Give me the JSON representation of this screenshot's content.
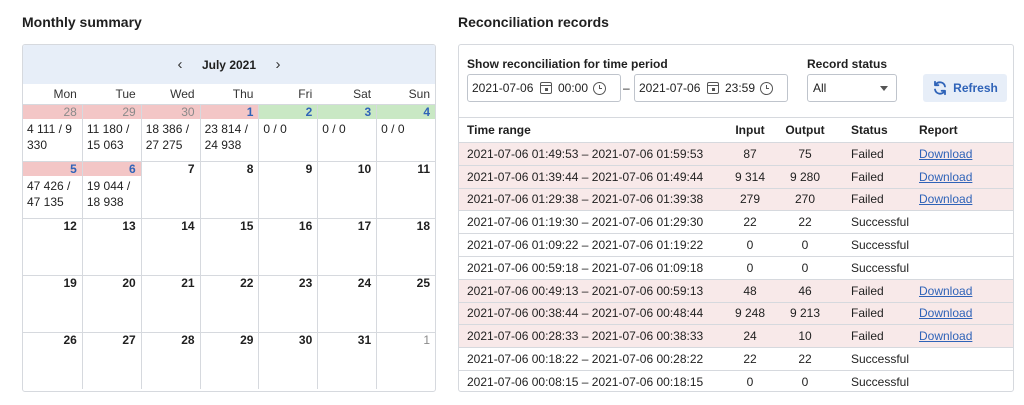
{
  "left_title": "Monthly summary",
  "right_title": "Reconciliation records",
  "calendar": {
    "month_label": "July 2021",
    "prev_symbol": "‹",
    "next_symbol": "›",
    "weekdays": [
      "Mon",
      "Tue",
      "Wed",
      "Thu",
      "Fri",
      "Sat",
      "Sun"
    ],
    "days": [
      {
        "num": "28",
        "value": "4 111 / 9 330",
        "status": "failed",
        "other_month": true
      },
      {
        "num": "29",
        "value": "11 180 / 15 063",
        "status": "failed",
        "other_month": true
      },
      {
        "num": "30",
        "value": "18 386 / 27 275",
        "status": "failed",
        "other_month": true
      },
      {
        "num": "1",
        "value": "23 814 / 24 938",
        "status": "failed",
        "other_month": false
      },
      {
        "num": "2",
        "value": "0 / 0",
        "status": "successful",
        "other_month": false
      },
      {
        "num": "3",
        "value": "0 / 0",
        "status": "successful",
        "other_month": false
      },
      {
        "num": "4",
        "value": "0 / 0",
        "status": "successful",
        "other_month": false
      },
      {
        "num": "5",
        "value": "47 426 / 47 135",
        "status": "failed",
        "other_month": false
      },
      {
        "num": "6",
        "value": "19 044 / 18 938",
        "status": "failed",
        "other_month": false
      },
      {
        "num": "7",
        "value": "",
        "status": "",
        "other_month": false
      },
      {
        "num": "8",
        "value": "",
        "status": "",
        "other_month": false
      },
      {
        "num": "9",
        "value": "",
        "status": "",
        "other_month": false
      },
      {
        "num": "10",
        "value": "",
        "status": "",
        "other_month": false
      },
      {
        "num": "11",
        "value": "",
        "status": "",
        "other_month": false
      },
      {
        "num": "12",
        "value": "",
        "status": "",
        "other_month": false
      },
      {
        "num": "13",
        "value": "",
        "status": "",
        "other_month": false
      },
      {
        "num": "14",
        "value": "",
        "status": "",
        "other_month": false
      },
      {
        "num": "15",
        "value": "",
        "status": "",
        "other_month": false
      },
      {
        "num": "16",
        "value": "",
        "status": "",
        "other_month": false
      },
      {
        "num": "17",
        "value": "",
        "status": "",
        "other_month": false
      },
      {
        "num": "18",
        "value": "",
        "status": "",
        "other_month": false
      },
      {
        "num": "19",
        "value": "",
        "status": "",
        "other_month": false
      },
      {
        "num": "20",
        "value": "",
        "status": "",
        "other_month": false
      },
      {
        "num": "21",
        "value": "",
        "status": "",
        "other_month": false
      },
      {
        "num": "22",
        "value": "",
        "status": "",
        "other_month": false
      },
      {
        "num": "23",
        "value": "",
        "status": "",
        "other_month": false
      },
      {
        "num": "24",
        "value": "",
        "status": "",
        "other_month": false
      },
      {
        "num": "25",
        "value": "",
        "status": "",
        "other_month": false
      },
      {
        "num": "26",
        "value": "",
        "status": "",
        "other_month": false
      },
      {
        "num": "27",
        "value": "",
        "status": "",
        "other_month": false
      },
      {
        "num": "28",
        "value": "",
        "status": "",
        "other_month": false
      },
      {
        "num": "29",
        "value": "",
        "status": "",
        "other_month": false
      },
      {
        "num": "30",
        "value": "",
        "status": "",
        "other_month": false
      },
      {
        "num": "31",
        "value": "",
        "status": "",
        "other_month": false
      },
      {
        "num": "1",
        "value": "",
        "status": "",
        "other_month": true
      }
    ]
  },
  "filters": {
    "period_label": "Show reconciliation for time period",
    "from_date": "2021-07-06",
    "from_time": "00:00",
    "separator": "–",
    "to_date": "2021-07-06",
    "to_time": "23:59",
    "status_label": "Record status",
    "status_value": "All",
    "refresh_label": "Refresh"
  },
  "table": {
    "headers": {
      "range": "Time range",
      "input": "Input",
      "output": "Output",
      "status": "Status",
      "report": "Report"
    },
    "rows": [
      {
        "range": "2021-07-06 01:49:53 – 2021-07-06 01:59:53",
        "input": "87",
        "output": "75",
        "status": "Failed",
        "report": "Download"
      },
      {
        "range": "2021-07-06 01:39:44 – 2021-07-06 01:49:44",
        "input": "9 314",
        "output": "9 280",
        "status": "Failed",
        "report": "Download"
      },
      {
        "range": "2021-07-06 01:29:38 – 2021-07-06 01:39:38",
        "input": "279",
        "output": "270",
        "status": "Failed",
        "report": "Download"
      },
      {
        "range": "2021-07-06 01:19:30 – 2021-07-06 01:29:30",
        "input": "22",
        "output": "22",
        "status": "Successful",
        "report": ""
      },
      {
        "range": "2021-07-06 01:09:22 – 2021-07-06 01:19:22",
        "input": "0",
        "output": "0",
        "status": "Successful",
        "report": ""
      },
      {
        "range": "2021-07-06 00:59:18 – 2021-07-06 01:09:18",
        "input": "0",
        "output": "0",
        "status": "Successful",
        "report": ""
      },
      {
        "range": "2021-07-06 00:49:13 – 2021-07-06 00:59:13",
        "input": "48",
        "output": "46",
        "status": "Failed",
        "report": "Download"
      },
      {
        "range": "2021-07-06 00:38:44 – 2021-07-06 00:48:44",
        "input": "9 248",
        "output": "9 213",
        "status": "Failed",
        "report": "Download"
      },
      {
        "range": "2021-07-06 00:28:33 – 2021-07-06 00:38:33",
        "input": "24",
        "output": "10",
        "status": "Failed",
        "report": "Download"
      },
      {
        "range": "2021-07-06 00:18:22 – 2021-07-06 00:28:22",
        "input": "22",
        "output": "22",
        "status": "Successful",
        "report": ""
      },
      {
        "range": "2021-07-06 00:08:15 – 2021-07-06 00:18:15",
        "input": "0",
        "output": "0",
        "status": "Successful",
        "report": ""
      }
    ]
  },
  "colors": {
    "failed_bg": "#f3c6c6",
    "success_bg": "#c9e8c4",
    "row_failed_bg": "#f8e9e9",
    "accent": "#2f63b8",
    "header_bg": "#e7eef8"
  },
  "icons": {
    "prev": "chevron-left-icon",
    "next": "chevron-right-icon",
    "date": "calendar-icon",
    "time": "clock-icon",
    "select": "chevron-down-icon",
    "refresh": "refresh-icon"
  }
}
